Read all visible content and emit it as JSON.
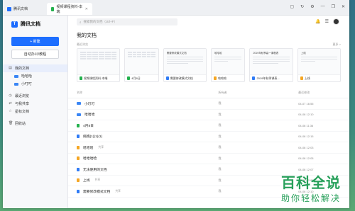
{
  "browser": {
    "tabs": [
      {
        "label": "腾讯文档"
      },
      {
        "label": "视频课程资料-本端"
      }
    ]
  },
  "sidebar": {
    "brand": "腾讯文档",
    "new_button": "+ 新建",
    "auto_button": "自动办公/教程",
    "items": [
      {
        "label": "我的文档"
      },
      {
        "label": "哈哈哈"
      },
      {
        "label": "小叮叮"
      },
      {
        "label": "最近浏览"
      },
      {
        "label": "与我共享"
      },
      {
        "label": "星标文档"
      },
      {
        "label": "回收站"
      }
    ]
  },
  "topbar": {
    "search_placeholder": "搜索我的文档（ctrl+F）"
  },
  "main": {
    "title": "我的文档",
    "recent_label": "最近浏览",
    "recent_more": "更多 >",
    "cards": [
      {
        "name": "视频课程资料-本端",
        "type": "sheet"
      },
      {
        "name": "4月8日",
        "type": "sheet"
      },
      {
        "name": "需要修改模式文档",
        "type": "doc",
        "thumb_title": "需要修改模式文档"
      },
      {
        "name": "哈哈哈",
        "type": "docy",
        "thumb_title": "哈哈哈"
      },
      {
        "name": "2019年秋季课表...",
        "type": "doc",
        "thumb_title": "2019年秋季高一课程表"
      },
      {
        "name": "上线",
        "type": "docy",
        "thumb_title": "上线"
      }
    ],
    "columns": {
      "name": "名称",
      "owner": "所有者",
      "time": "最近修改"
    },
    "rows": [
      {
        "name": "小叮叮",
        "type": "folder",
        "shared": "",
        "owner": "我",
        "time": "04-07 16:55"
      },
      {
        "name": "哈哈哈",
        "type": "folder",
        "shared": "",
        "owner": "我",
        "time": "04-08 12:10"
      },
      {
        "name": "4月8日",
        "type": "sheet",
        "shared": "",
        "owner": "我",
        "time": "04-08 11:36"
      },
      {
        "name": "拖拽(1)(1)(1)",
        "type": "doc",
        "shared": "",
        "owner": "我",
        "time": "04-08 12:15"
      },
      {
        "name": "哈哈哈",
        "type": "docy",
        "shared": "共享",
        "owner": "我",
        "time": "04-08 12:03"
      },
      {
        "name": "哈哈哈哈",
        "type": "docy",
        "shared": "",
        "owner": "我",
        "time": "04-08 12:05"
      },
      {
        "name": "无法使用的文档",
        "type": "doc",
        "shared": "",
        "owner": "我",
        "time": "04-08 12:07"
      },
      {
        "name": "上线",
        "type": "docy",
        "shared": "共享",
        "owner": "我",
        "time": "04-08 12:09"
      },
      {
        "name": "需要修改模式文档",
        "type": "doc",
        "shared": "共享",
        "owner": "我",
        "time": "04-08 12:10"
      }
    ]
  },
  "watermark": {
    "big": "百科全说",
    "small": "助你轻松解决"
  },
  "colors": {
    "accent": "#1e6fff",
    "sheet": "#23b14d",
    "doc": "#2f7bf6",
    "folder": "#3a86f5"
  }
}
